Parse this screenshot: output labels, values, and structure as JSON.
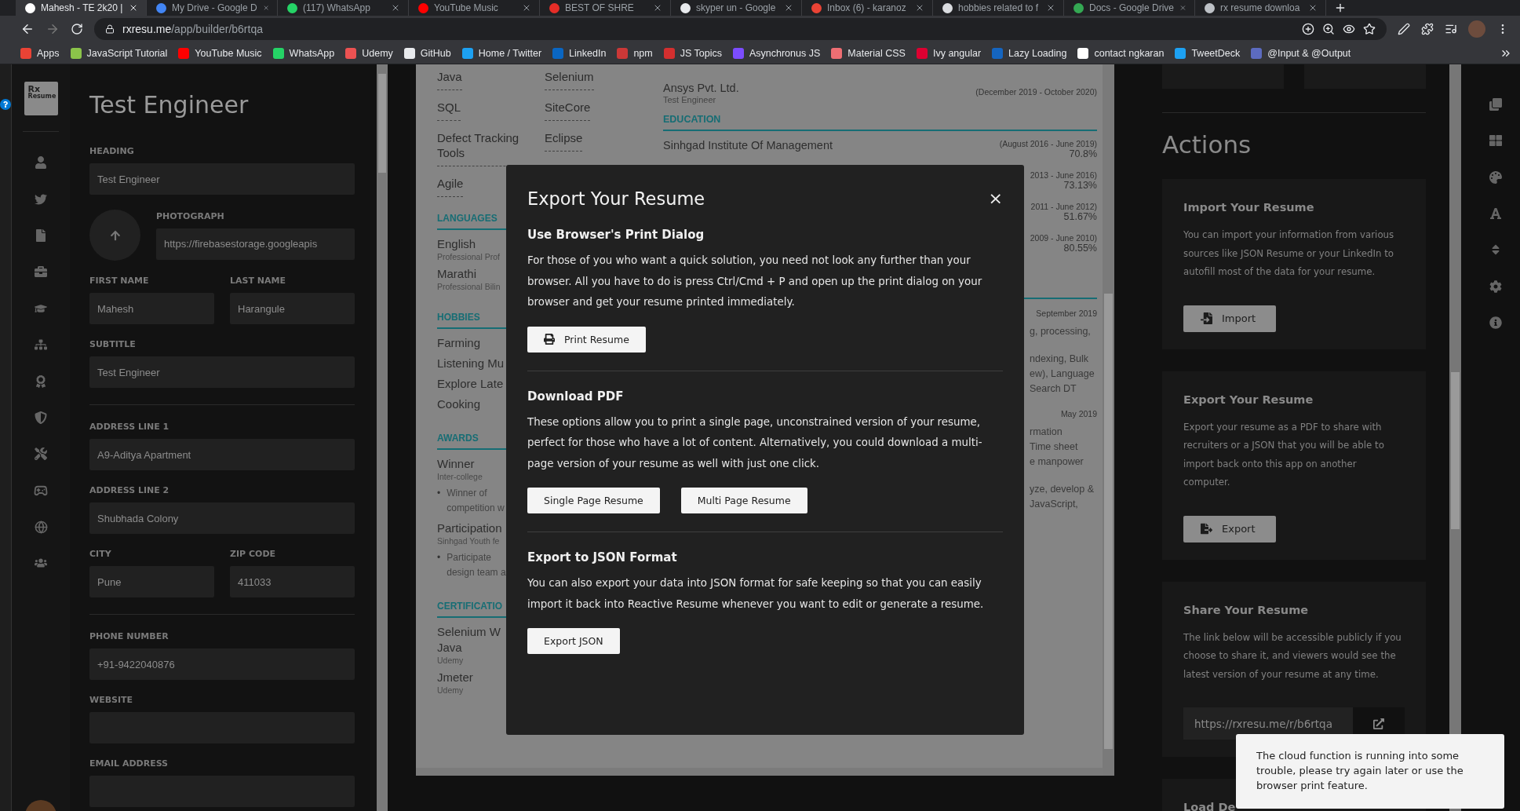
{
  "browser": {
    "tabs": [
      {
        "title": "Mahesh - TE 2k20 |",
        "color": "#ffffff",
        "selected": true
      },
      {
        "title": "My Drive - Google D",
        "color": "#4285f4",
        "selected": false
      },
      {
        "title": "(117) WhatsApp",
        "color": "#25d366",
        "selected": false
      },
      {
        "title": "YouTube Music",
        "color": "#ff0000",
        "selected": false
      },
      {
        "title": "BEST OF SHRE",
        "color": "#e52d27",
        "selected": false
      },
      {
        "title": "skyper un - Google",
        "color": "#e8eaed",
        "selected": false
      },
      {
        "title": "Inbox (6) - karanoz",
        "color": "#ea4335",
        "selected": false
      },
      {
        "title": "hobbies related to f",
        "color": "#dadce0",
        "selected": false
      },
      {
        "title": "Docs - Google Drive",
        "color": "#34a853",
        "selected": false
      },
      {
        "title": "rx resume downloa",
        "color": "#bdc1c6",
        "selected": false
      }
    ],
    "url_host": "rxresu.me",
    "url_path": "/app/builder/b6rtqa",
    "bookmarks": [
      {
        "label": "Apps",
        "color": "#ea4335"
      },
      {
        "label": "JavaScript Tutorial",
        "color": "#8bc34a"
      },
      {
        "label": "YouTube Music",
        "color": "#ff0000"
      },
      {
        "label": "WhatsApp",
        "color": "#25d366"
      },
      {
        "label": "Udemy",
        "color": "#ec5252"
      },
      {
        "label": "GitHub",
        "color": "#e8eaed"
      },
      {
        "label": "Home / Twitter",
        "color": "#1da1f2"
      },
      {
        "label": "LinkedIn",
        "color": "#0a66c2"
      },
      {
        "label": "npm",
        "color": "#cb3837"
      },
      {
        "label": "JS Topics",
        "color": "#d32f2f"
      },
      {
        "label": "Asynchronus JS",
        "color": "#7c4dff"
      },
      {
        "label": "Material CSS",
        "color": "#ee6e73"
      },
      {
        "label": "Ivy angular",
        "color": "#dd0031"
      },
      {
        "label": "Lazy Loading",
        "color": "#1565c0"
      },
      {
        "label": "contact ngkaran",
        "color": "#ffffff"
      },
      {
        "label": "TweetDeck",
        "color": "#1da1f2"
      },
      {
        "label": "@Input & @Output",
        "color": "#5c6bc0"
      }
    ]
  },
  "logo": {
    "mark": "Rx",
    "word": "Resume"
  },
  "form": {
    "title": "Test Engineer",
    "rows": [
      {
        "kind": "fields",
        "fields": [
          {
            "label": "HEADING",
            "value": "Test Engineer"
          }
        ]
      },
      {
        "kind": "photo",
        "fields": [
          {
            "label": "PHOTOGRAPH",
            "value": "https://firebasestorage.googleapis"
          }
        ]
      },
      {
        "kind": "fields",
        "fields": [
          {
            "label": "FIRST NAME",
            "value": "Mahesh"
          },
          {
            "label": "LAST NAME",
            "value": "Harangule"
          }
        ]
      },
      {
        "kind": "fields",
        "fields": [
          {
            "label": "SUBTITLE",
            "value": "Test Engineer"
          }
        ]
      },
      {
        "kind": "divider"
      },
      {
        "kind": "fields",
        "fields": [
          {
            "label": "ADDRESS LINE 1",
            "value": "A9-Aditya Apartment"
          }
        ]
      },
      {
        "kind": "fields",
        "fields": [
          {
            "label": "ADDRESS LINE 2",
            "value": "Shubhada Colony"
          }
        ]
      },
      {
        "kind": "fields",
        "fields": [
          {
            "label": "CITY",
            "value": "Pune"
          },
          {
            "label": "ZIP CODE",
            "value": "411033"
          }
        ]
      },
      {
        "kind": "divider"
      },
      {
        "kind": "fields",
        "fields": [
          {
            "label": "PHONE NUMBER",
            "value": "+91-9422040876"
          }
        ]
      },
      {
        "kind": "fields",
        "fields": [
          {
            "label": "WEBSITE"
          }
        ]
      },
      {
        "kind": "fields",
        "fields": [
          {
            "label": "EMAIL ADDRESS"
          }
        ]
      }
    ]
  },
  "resume": {
    "skills": [
      "Java",
      "Selenium",
      "SQL",
      "SiteCore",
      "Defect Tracking Tools",
      "Eclipse",
      "Agile"
    ],
    "sections": [
      {
        "heading": "LANGUAGES",
        "items": [
          {
            "title": "English",
            "subtitle": "Professional Prof"
          },
          {
            "title": "Marathi",
            "subtitle": "Professional Bilin"
          }
        ]
      },
      {
        "heading": "HOBBIES",
        "items": [
          {
            "title": "Farming"
          },
          {
            "title": "Listening Mu"
          },
          {
            "title": "Explore Late"
          },
          {
            "title": "Cooking"
          }
        ]
      },
      {
        "heading": "AWARDS",
        "items": [
          {
            "title": "Winner",
            "subtitle": "Inter-college",
            "bullet": "•",
            "text": "Winner of\ncompetition w"
          },
          {
            "title": "Participation",
            "subtitle": "Sinhgad Youth fe",
            "bullet": "•",
            "text": "Participate\ndesign team a"
          }
        ]
      },
      {
        "heading": "CERTIFICATIO",
        "items": [
          {
            "title": "Selenium W\nJava",
            "subtitle": "Udemy"
          },
          {
            "title": "Jmeter",
            "subtitle": "Udemy"
          }
        ]
      }
    ],
    "work": {
      "company": "Ansys Pvt. Ltd.",
      "role": "Test Engineer",
      "dates": "(December 2019 - October 2020)"
    },
    "education": {
      "heading": "EDUCATION",
      "entries": [
        {
          "institution": "Sinhgad Institute Of Management",
          "dates": "(August 2016 - June 2019)",
          "score": "70.8%"
        },
        {
          "dates": "2013 - June 2016)",
          "score": "73.13%"
        },
        {
          "dates": "2011 - June 2012)",
          "score": "51.67%"
        },
        {
          "dates": "2009 - June 2010)",
          "score": "80.55%"
        }
      ]
    },
    "fragments": [
      {
        "date": "September 2019",
        "lines": [
          "g, processing,"
        ]
      },
      {
        "lines": [
          "ndexing, Bulk",
          "ew), Language",
          "Search DT"
        ]
      },
      {
        "date": "May 2019",
        "lines": [
          "rmation",
          "Time sheet",
          "e manpower"
        ]
      },
      {
        "lines": [
          "yze, develop &",
          "JavaScript,"
        ]
      }
    ]
  },
  "actions": {
    "title": "Actions",
    "cards": [
      {
        "kind": "button",
        "title": "Import Your Resume",
        "text": "You can import your information from various sources like JSON Resume or your LinkedIn to autofill most of the data for your resume.",
        "button": "Import"
      },
      {
        "kind": "button",
        "title": "Export Your Resume",
        "text": "Export your resume as a PDF to share with recruiters or a JSON that you will be able to import back onto this app on another computer.",
        "button": "Export"
      },
      {
        "kind": "link",
        "title": "Share Your Resume",
        "text": "The link below will be accessible publicly if you choose to share it, and viewers would see the latest version of your resume at any time.",
        "link": "https://rxresu.me/r/b6rtqa"
      },
      {
        "kind": "title",
        "title": "Load De"
      }
    ]
  },
  "modal": {
    "title": "Export Your Resume",
    "close": "×",
    "sections": [
      {
        "heading": "Use Browser's Print Dialog",
        "text": "For those of you who want a quick solution, you need not look any further than your browser. All you have to do is press Ctrl/Cmd + P and open up the print dialog on your browser and get your resume printed immediately.",
        "buttons": [
          {
            "label": "Print Resume",
            "kind": "icon"
          }
        ]
      },
      {
        "heading": "Download PDF",
        "text": "These options allow you to print a single page, unconstrained version of your resume, perfect for those who have a lot of content. Alternatively, you could download a multi-page version of your resume as well with just one click.",
        "buttons": [
          {
            "label": "Single Page Resume",
            "kind": "plain"
          },
          {
            "label": "Multi Page Resume",
            "kind": "plain"
          }
        ]
      },
      {
        "heading": "Export to JSON Format",
        "text": "You can also export your data into JSON format for safe keeping so that you can easily import it back into Reactive Resume whenever you want to edit or generate a resume.",
        "buttons": [
          {
            "label": "Export JSON",
            "kind": "plain"
          }
        ]
      }
    ]
  },
  "toast": {
    "text": "The cloud function is running into some trouble, please try again later or use the browser print feature."
  }
}
